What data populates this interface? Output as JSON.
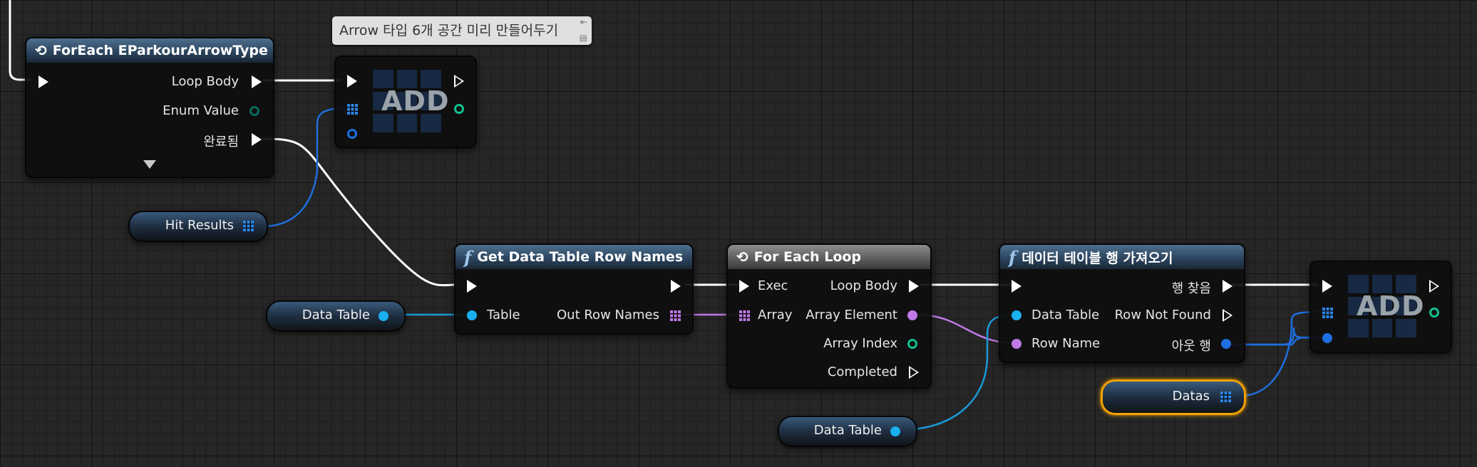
{
  "comment": {
    "text": "Arrow 타입 6개 공간 미리 만들어두기",
    "pin_glyph": "⇤",
    "bubble_glyph": "▤"
  },
  "foreach_enum": {
    "title": "ForEach EParkourArrowType",
    "icon": "loop-icon",
    "pins": {
      "loop_body": "Loop Body",
      "enum_value": "Enum Value",
      "completed": "완료됨"
    }
  },
  "add_node_1": {
    "label": "ADD"
  },
  "add_node_2": {
    "label": "ADD"
  },
  "hit_results": {
    "label": "Hit Results"
  },
  "get_row_names": {
    "title": "Get Data Table Row Names",
    "icon": "function-icon",
    "icon_glyph": "f",
    "pins": {
      "table": "Table",
      "out_row_names": "Out Row Names"
    }
  },
  "data_table_var_1": {
    "label": "Data Table"
  },
  "for_each_loop": {
    "title": "For Each Loop",
    "icon": "loop-icon",
    "pins": {
      "exec": "Exec",
      "array": "Array",
      "loop_body": "Loop Body",
      "array_element": "Array Element",
      "array_index": "Array Index",
      "completed": "Completed"
    }
  },
  "get_data_table_row": {
    "title": "데이터 테이블 행 가져오기",
    "icon": "function-icon",
    "icon_glyph": "f",
    "pins": {
      "data_table": "Data Table",
      "row_name": "Row Name",
      "row_found": "행 찾음",
      "row_not_found": "Row Not Found",
      "out_row": "아웃 행"
    }
  },
  "data_table_var_2": {
    "label": "Data Table"
  },
  "datas_var": {
    "label": "Datas"
  },
  "colors": {
    "exec": "#ffffff",
    "struct_wire": "#1a9ad8",
    "name_wire": "#c07ae8",
    "object_wire": "#1e6fe0",
    "enum_pin": "#10c090",
    "selection": "#f2a100"
  }
}
